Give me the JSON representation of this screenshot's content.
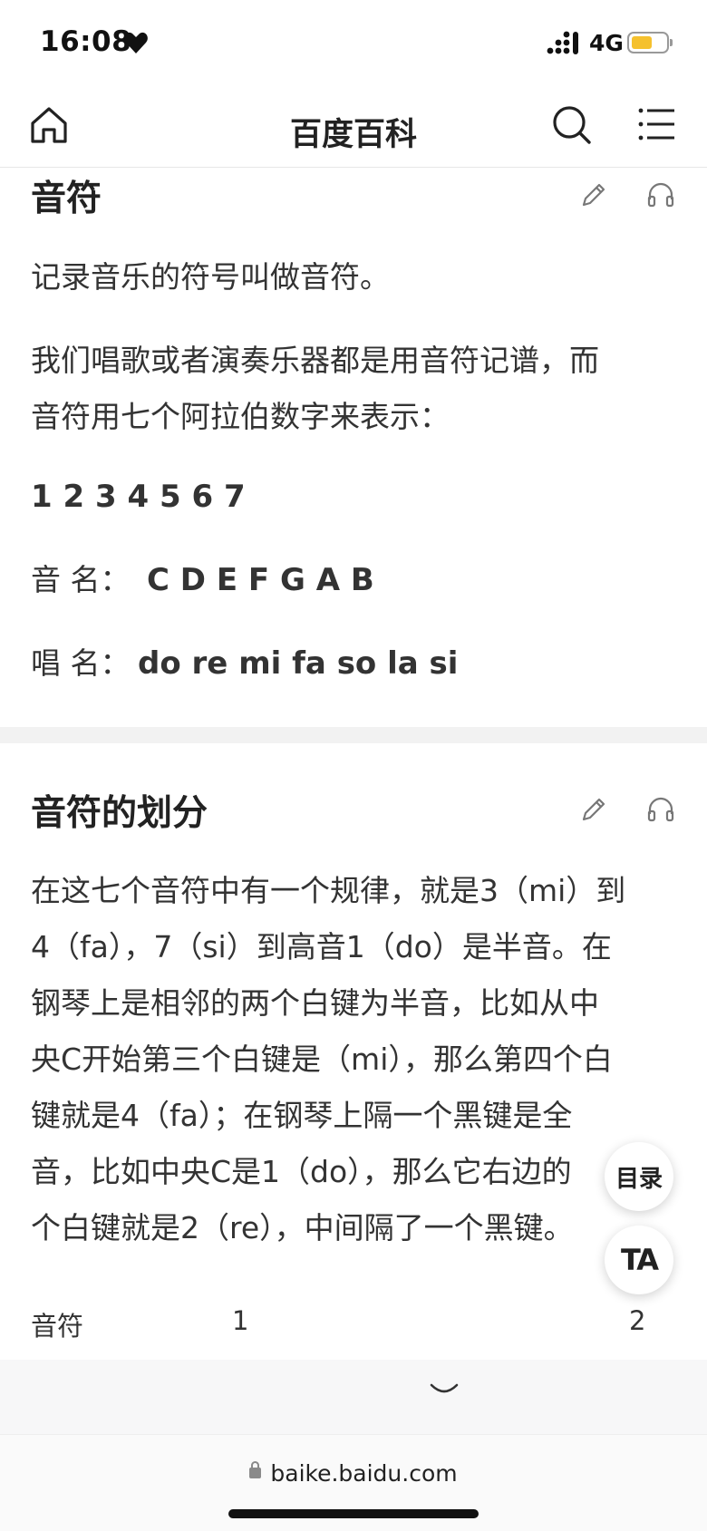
{
  "status_bar": {
    "time": "16:08",
    "network": "4G",
    "battery_color": "#f5c12e"
  },
  "nav": {
    "title": "百度百科",
    "icons": [
      "home-icon",
      "search-icon",
      "menu-icon"
    ]
  },
  "section1": {
    "title": "音符",
    "paragraphs": [
      "记录音乐的符号叫做音符。",
      "我们唱歌或者演奏乐器都是用音符记谱，而",
      "音符用七个阿拉伯数字来表示："
    ],
    "digits": "1 2 3 4 5 6 7",
    "note_name_label": "音 名：",
    "note_names": "C D E F G A B",
    "solfege_label": "唱 名：",
    "solfege": "do re mi fa so la si"
  },
  "section2": {
    "title": "音符的划分",
    "lines": [
      "在这七个音符中有一个规律，就是3（mi）到",
      "4（fa），7（si）到高音1（do）是半音。在",
      "钢琴上是相邻的两个白键为半音，比如从中",
      "央C开始第三个白键是（mi），那么第四个白",
      "键就是4（fa）；在钢琴上隔一个黑键是全",
      "音，比如中央C是1（do），那么它右边的",
      "个白键就是2（re），中间隔了一个黑键。"
    ]
  },
  "fabs": {
    "toc_label": "目录",
    "ta_label": "TA"
  },
  "table": {
    "row_label": "音符",
    "col1": "1",
    "col2": "2"
  },
  "url_bar": {
    "url": "baike.baidu.com"
  }
}
